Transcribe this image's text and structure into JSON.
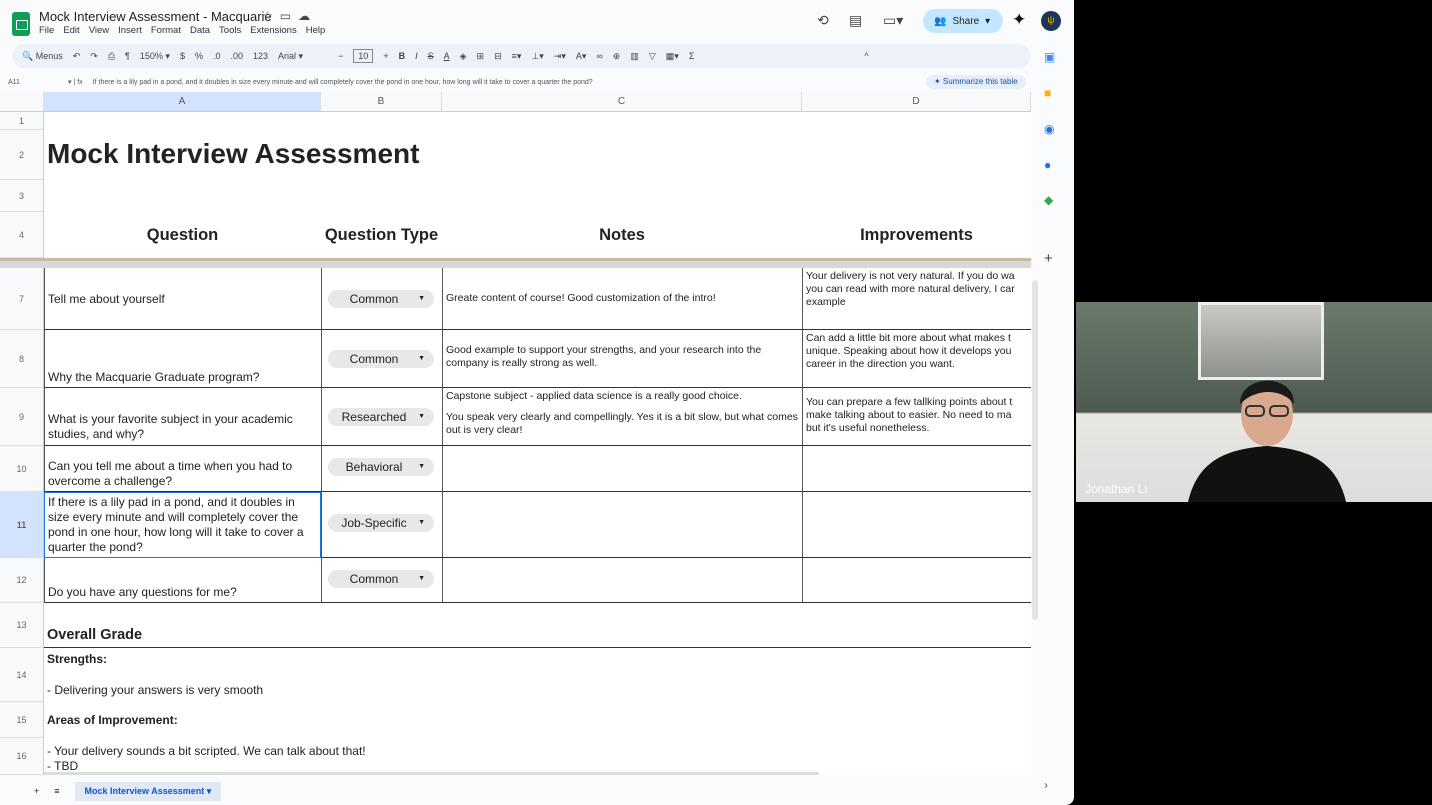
{
  "app": {
    "title": "Mock Interview Assessment  - Macquarie",
    "menu": [
      "File",
      "Edit",
      "View",
      "Insert",
      "Format",
      "Data",
      "Tools",
      "Extensions",
      "Help"
    ],
    "share": "Share"
  },
  "toolbar": {
    "search": "Menus",
    "zoom": "150%",
    "font": "Arial",
    "font_size": "10",
    "items": [
      "$",
      "%",
      ".0",
      ".00",
      "123"
    ]
  },
  "formula": {
    "cell_ref": "A11",
    "value": "If there is a lily pad in a pond, and it doubles in size every minute and will completely cover the pond in one hour, how long will it take to cover a quarter the pond?",
    "summarize": "✦ Summarize this table"
  },
  "columns": [
    "A",
    "B",
    "C",
    "D"
  ],
  "rows": [
    "1",
    "2",
    "3",
    "4",
    "7",
    "8",
    "9",
    "10",
    "11",
    "12",
    "13",
    "14",
    "15",
    "16"
  ],
  "sheet": {
    "title": "Mock Interview Assessment",
    "headers": [
      "Question",
      "Question Type",
      "Notes",
      "Improvements"
    ],
    "entries": [
      {
        "q": "Tell me about yourself",
        "type": "Common",
        "notes": "Greate content of course! Good customization of the intro!",
        "imp": "Your delivery is not very natural. If you do wa you can read with more natural delivery, I car example"
      },
      {
        "q": "Why the Macquarie Graduate program?",
        "type": "Common",
        "notes": "Good example to support your strengths, and your research into the company is really strong as well.",
        "imp": "Can add a little bit more about what makes t unique. Speaking about how it develops you career in the direction you want."
      },
      {
        "q": "What is your favorite subject in your academic studies, and why?",
        "type": "Researched",
        "notes": "Capstone subject - applied data science is a really good choice.",
        "notes2": "You speak very clearly and compellingly. Yes it is a bit slow, but what comes out is very clear!",
        "imp": "You can prepare a few tallking points about t make talking about to easier. No need to ma but it's useful nonetheless."
      },
      {
        "q": "Can you tell me about a time when you had to overcome a challenge?",
        "type": "Behavioral",
        "notes": "",
        "imp": ""
      },
      {
        "q": "If there is a lily pad in a pond, and it doubles in size every minute and will completely cover the pond in one hour, how long will it take to cover a quarter the pond?",
        "type": "Job-Specific",
        "notes": "",
        "imp": ""
      },
      {
        "q": "Do you have any questions for me?",
        "type": "Common",
        "notes": "",
        "imp": ""
      }
    ],
    "overall": "Overall Grade",
    "strengths_label": "Strengths:",
    "strength1": "- Delivering your answers is very smooth",
    "areas_label": "Areas of Improvement:",
    "area1": "- Your delivery sounds a bit scripted. We can talk about that!",
    "area2": "- TBD"
  },
  "tabs": {
    "active": "Mock Interview Assessment"
  },
  "video": {
    "name": "Jonathan Li"
  }
}
